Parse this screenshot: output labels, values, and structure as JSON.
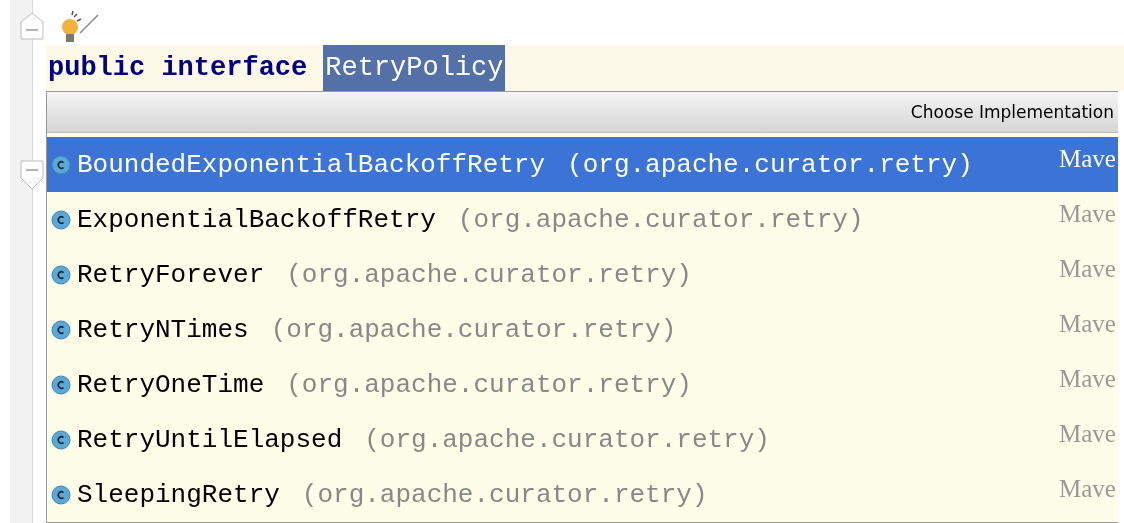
{
  "editor": {
    "code_line": {
      "keywords": "public interface",
      "identifier": "RetryPolicy",
      "identifier_selected": true
    }
  },
  "popup": {
    "title": "Choose Implementation",
    "items": [
      {
        "name": "BoundedExponentialBackoffRetry",
        "package": "(org.apache.curator.retry)",
        "source": "Mave",
        "selected": true
      },
      {
        "name": "ExponentialBackoffRetry",
        "package": "(org.apache.curator.retry)",
        "source": "Mave",
        "selected": false
      },
      {
        "name": "RetryForever",
        "package": "(org.apache.curator.retry)",
        "source": "Mave",
        "selected": false
      },
      {
        "name": "RetryNTimes",
        "package": "(org.apache.curator.retry)",
        "source": "Mave",
        "selected": false
      },
      {
        "name": "RetryOneTime",
        "package": "(org.apache.curator.retry)",
        "source": "Mave",
        "selected": false
      },
      {
        "name": "RetryUntilElapsed",
        "package": "(org.apache.curator.retry)",
        "source": "Mave",
        "selected": false
      },
      {
        "name": "SleepingRetry",
        "package": "(org.apache.curator.retry)",
        "source": "Mave",
        "selected": false
      }
    ]
  }
}
